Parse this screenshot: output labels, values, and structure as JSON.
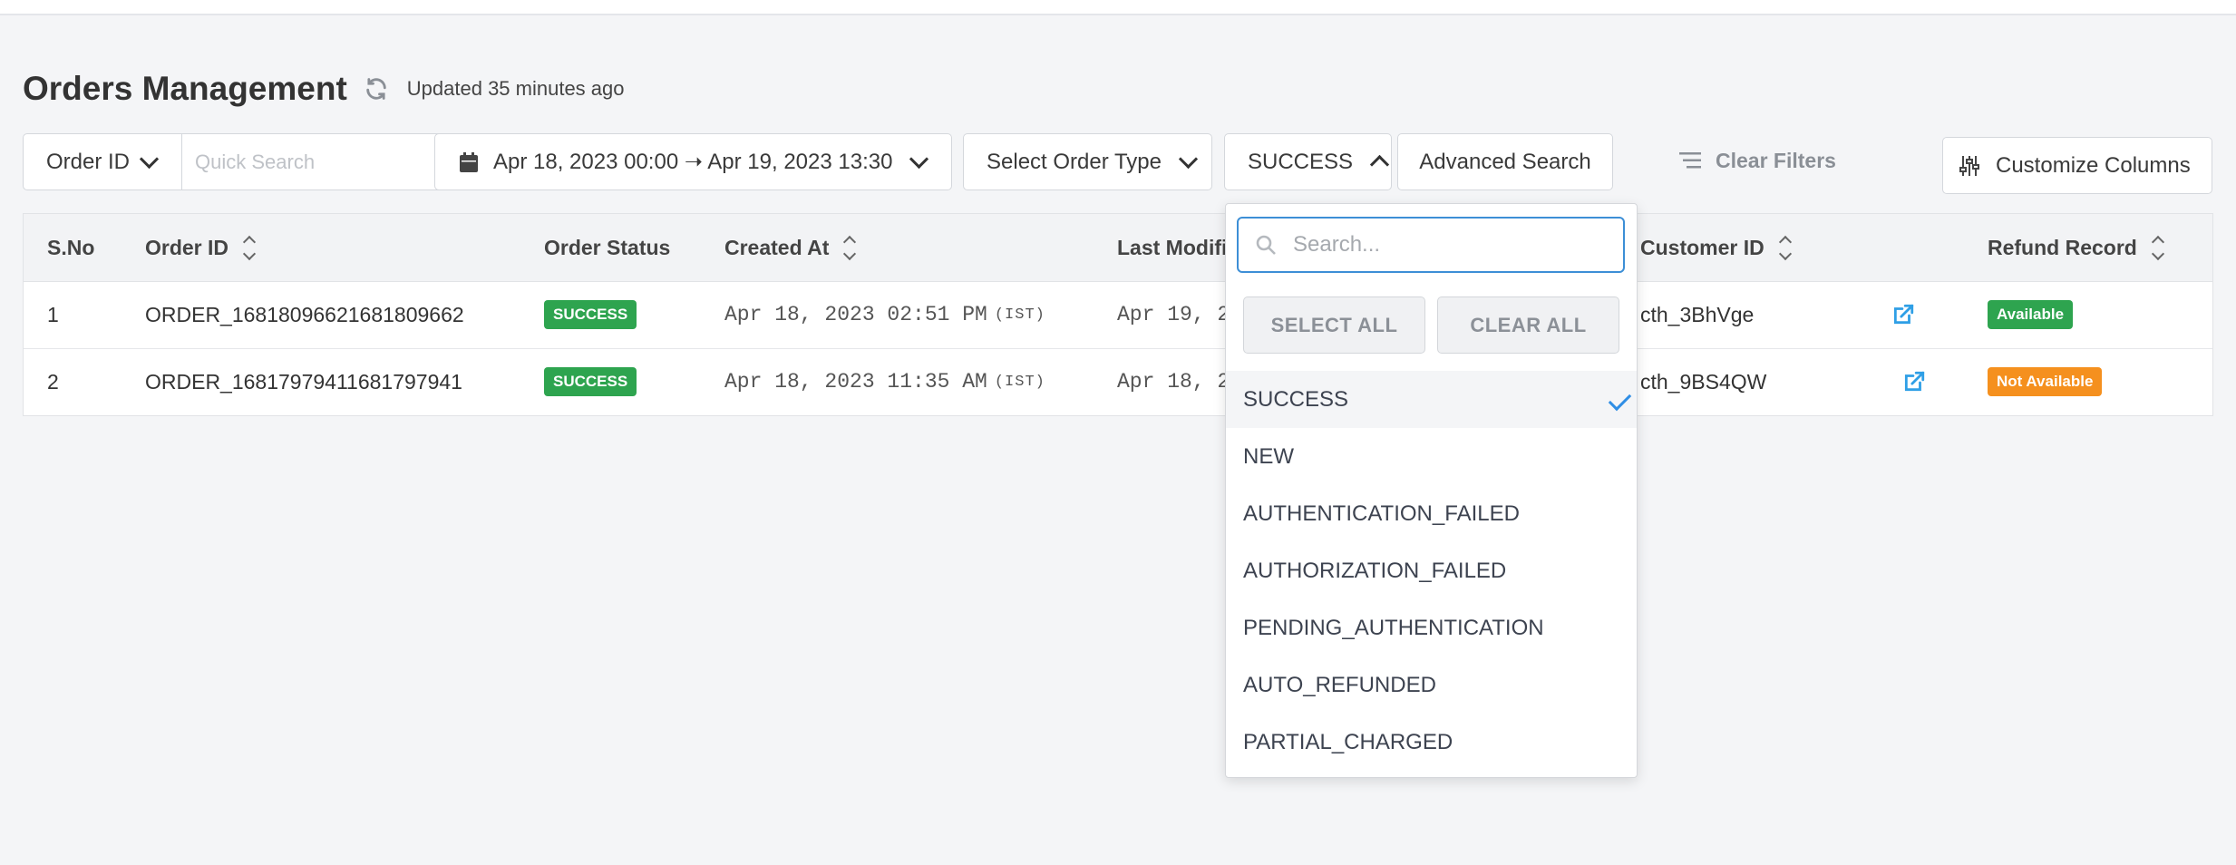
{
  "header": {
    "title": "Orders Management",
    "updated": "Updated 35 minutes ago"
  },
  "filters": {
    "search_type": "Order ID",
    "quick_search_placeholder": "Quick Search",
    "date_range": "Apr 18, 2023 00:00 ➝ Apr 19, 2023 13:30",
    "order_type": "Select Order Type",
    "status": "SUCCESS",
    "advanced_search": "Advanced Search",
    "clear_filters": "Clear Filters",
    "customize_columns": "Customize Columns"
  },
  "table": {
    "headers": [
      "S.No",
      "Order ID",
      "Order Status",
      "Created At",
      "Last Modifi",
      "Customer ID",
      "Refund Record"
    ],
    "rows": [
      {
        "sno": "1",
        "order_id": "ORDER_16818096621681809662",
        "status": "SUCCESS",
        "created": "Apr 18, 2023 02:51 PM",
        "tz": "(IST)",
        "modified": "Apr 19, 2",
        "customer": "cth_3BhVge",
        "refund": "Available"
      },
      {
        "sno": "2",
        "order_id": "ORDER_16817979411681797941",
        "status": "SUCCESS",
        "created": "Apr 18, 2023 11:35 AM",
        "tz": "(IST)",
        "modified": "Apr 18, 2",
        "customer": "cth_9BS4QW",
        "refund": "Not Available"
      }
    ]
  },
  "status_dropdown": {
    "search_placeholder": "Search...",
    "select_all": "SELECT ALL",
    "clear_all": "CLEAR ALL",
    "options": [
      "SUCCESS",
      "NEW",
      "AUTHENTICATION_FAILED",
      "AUTHORIZATION_FAILED",
      "PENDING_AUTHENTICATION",
      "AUTO_REFUNDED",
      "PARTIAL_CHARGED"
    ],
    "selected": "SUCCESS"
  },
  "colors": {
    "success": "#2ea44f",
    "warning": "#f5901e",
    "link": "#2f9fe6"
  }
}
